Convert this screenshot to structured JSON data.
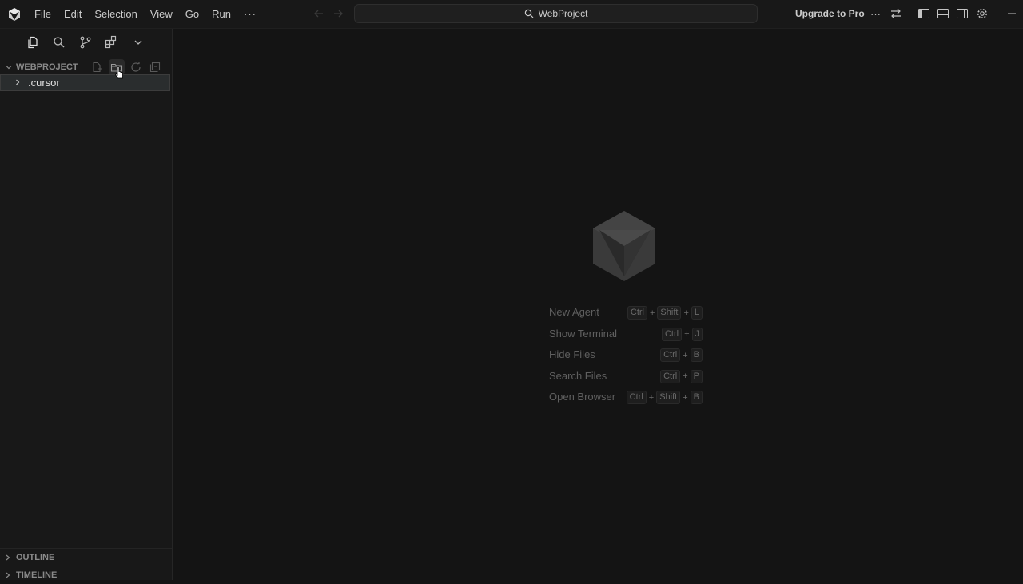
{
  "titlebar": {
    "menu": [
      "File",
      "Edit",
      "Selection",
      "View",
      "Go",
      "Run"
    ],
    "more": "···",
    "search_text": "WebProject",
    "upgrade_label": "Upgrade to Pro",
    "more_actions": "···"
  },
  "sidebar": {
    "explorer_title": "WEBPROJECT",
    "tree": [
      {
        "label": ".cursor"
      }
    ],
    "panels": [
      {
        "title": "OUTLINE"
      },
      {
        "title": "TIMELINE"
      }
    ]
  },
  "editor": {
    "shortcuts": [
      {
        "label": "New Agent",
        "keys": [
          "Ctrl",
          "Shift",
          "L"
        ]
      },
      {
        "label": "Show Terminal",
        "keys": [
          "Ctrl",
          "J"
        ]
      },
      {
        "label": "Hide Files",
        "keys": [
          "Ctrl",
          "B"
        ]
      },
      {
        "label": "Search Files",
        "keys": [
          "Ctrl",
          "P"
        ]
      },
      {
        "label": "Open Browser",
        "keys": [
          "Ctrl",
          "Shift",
          "B"
        ]
      }
    ]
  }
}
